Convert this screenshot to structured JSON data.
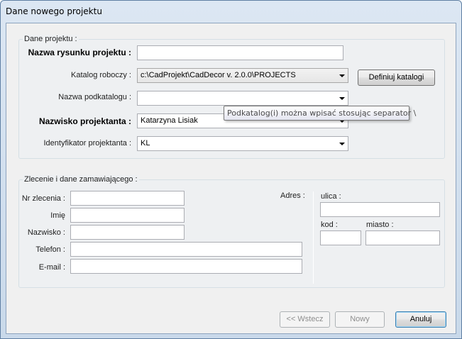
{
  "window": {
    "title": "Dane nowego projektu"
  },
  "project": {
    "legend": "Dane projektu :",
    "drawing_name_label": "Nazwa rysunku projektu :",
    "drawing_name_value": "",
    "work_dir_label": "Katalog roboczy :",
    "work_dir_value": "c:\\CadProjekt\\CadDecor v. 2.0.0\\PROJECTS",
    "define_dir_button": "Definiuj katalogi",
    "subdir_label": "Nazwa podkatalogu :",
    "subdir_value": "",
    "designer_label": "Nazwisko projektanta :",
    "designer_value": "Katarzyna Lisiak",
    "designer_id_label": "Identyfikator projektanta :",
    "designer_id_value": "KL",
    "tooltip": "Podkatalog(i) można wpisać stosując separator \\"
  },
  "order": {
    "legend": "Zlecenie i dane zamawiającego :",
    "order_no_label": "Nr zlecenia :",
    "order_no_value": "",
    "first_name_label": "Imię",
    "first_name_value": "",
    "last_name_label": "Nazwisko :",
    "last_name_value": "",
    "phone_label": "Telefon :",
    "phone_value": "",
    "email_label": "E-mail :",
    "email_value": "",
    "address_label": "Adres :",
    "street_label": "ulica :",
    "street_value": "",
    "postcode_label": "kod :",
    "postcode_value": "",
    "city_label": "miasto :",
    "city_value": ""
  },
  "footer": {
    "back_button": "<< Wstecz",
    "new_button": "Nowy",
    "cancel_button": "Anuluj"
  }
}
